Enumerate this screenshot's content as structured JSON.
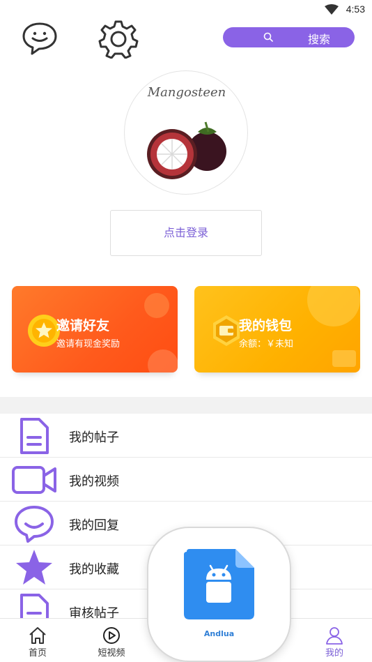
{
  "status": {
    "time": "4:53"
  },
  "header": {
    "search_label": "搜索",
    "accent": "#8a63e6"
  },
  "profile": {
    "avatar_text": "Mangosteen",
    "login_label": "点击登录"
  },
  "cards": [
    {
      "title": "邀请好友",
      "subtitle": "邀请有现金奖励",
      "color": "#ff5a1c"
    },
    {
      "title": "我的钱包",
      "subtitle": "余额：￥未知",
      "color": "#ffb100"
    }
  ],
  "menu": [
    {
      "label": "我的帖子",
      "icon": "document-icon"
    },
    {
      "label": "我的视频",
      "icon": "video-camera-icon"
    },
    {
      "label": "我的回复",
      "icon": "chat-bubble-icon"
    },
    {
      "label": "我的收藏",
      "icon": "star-icon"
    },
    {
      "label": "审核帖子",
      "icon": "document-icon"
    }
  ],
  "tabs": [
    {
      "label": "首页",
      "icon": "home-icon",
      "active": false
    },
    {
      "label": "短视频",
      "icon": "play-circle-icon",
      "active": false
    },
    {
      "label": "我的",
      "icon": "user-icon",
      "active": true
    }
  ],
  "overlay": {
    "app_name": "Andlua",
    "icon": "android-file-icon"
  }
}
